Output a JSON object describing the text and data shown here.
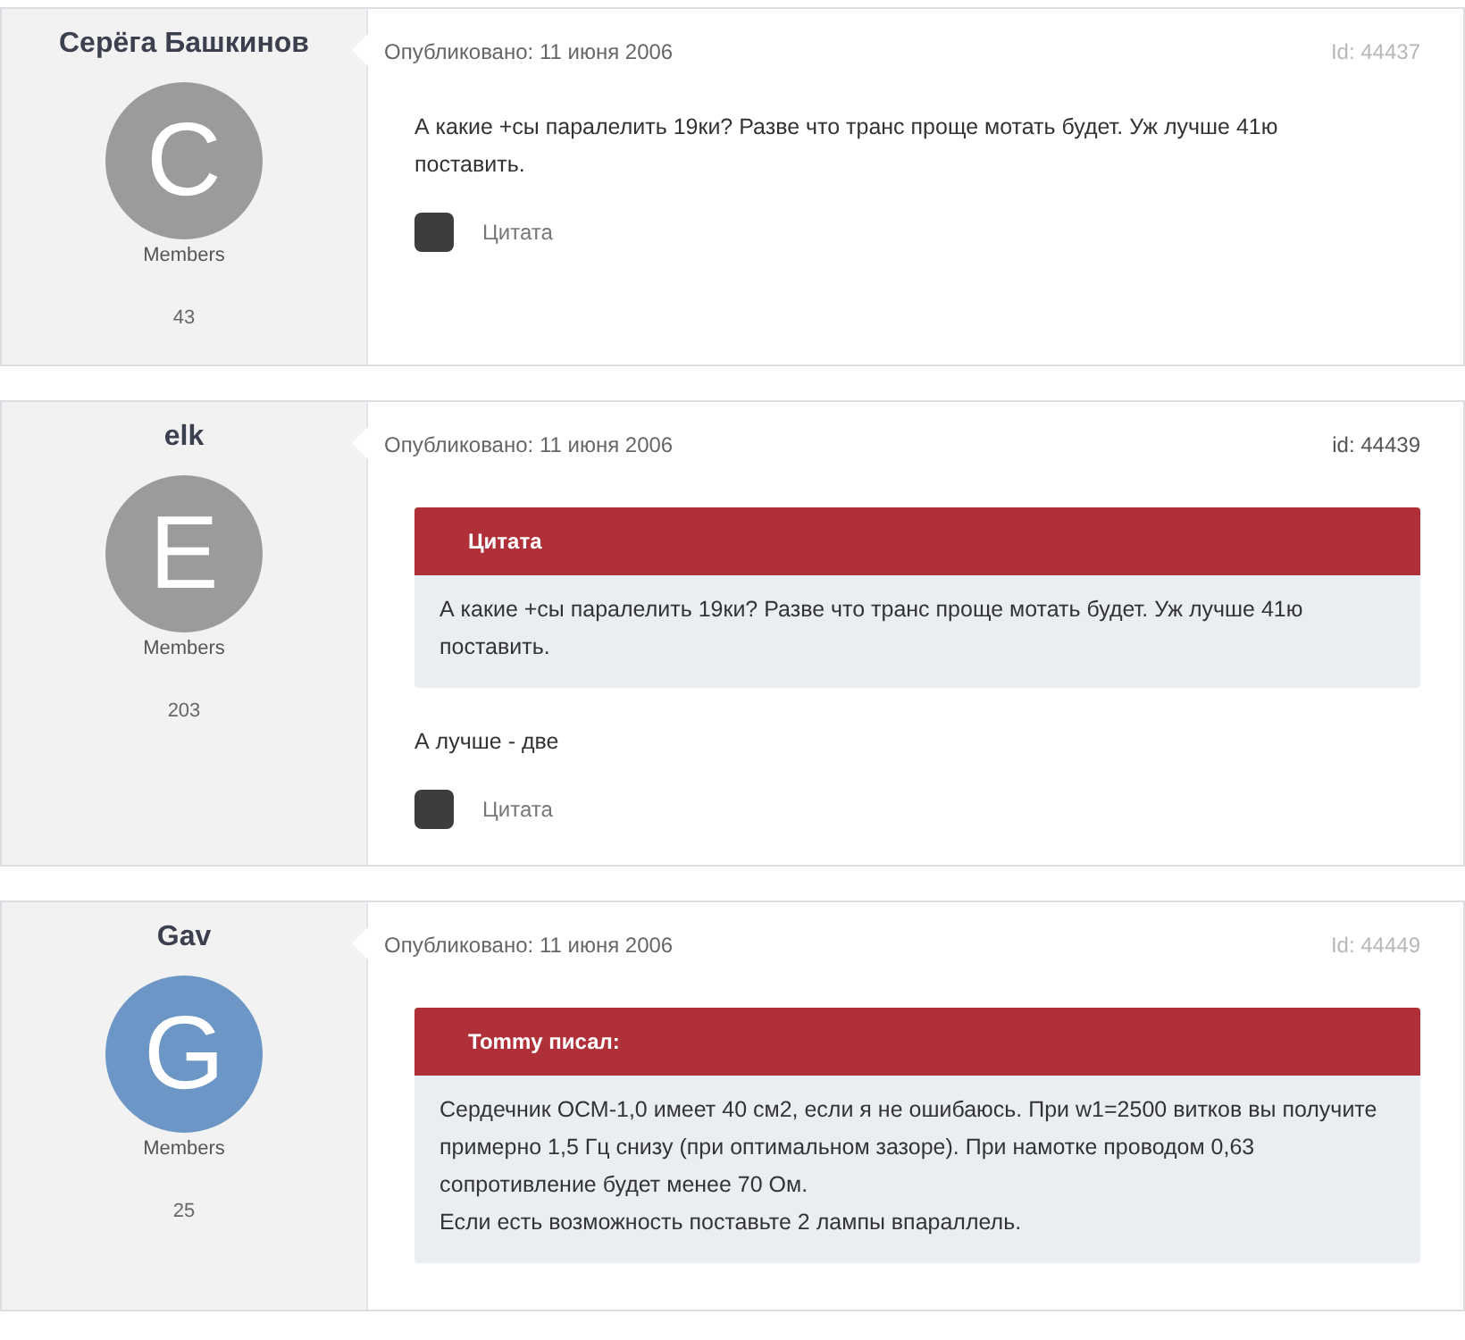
{
  "posts": [
    {
      "author": "Серёга Башкинов",
      "avatar_letter": "C",
      "color": "#9b9b9b",
      "group": "Members",
      "post_count": "43",
      "published": "Опубликовано: 11 июня 2006",
      "post_id": "Id: 44437",
      "id_dimmed": true,
      "paragraphs": [
        "А какие +сы паралелить 19ки? Разве что транс проще мотать будет. Уж лучше 41ю поставить."
      ],
      "quote_button": "Цитата"
    },
    {
      "author": "elk",
      "avatar_letter": "E",
      "color": "#9b9b9b",
      "group": "Members",
      "post_count": "203",
      "published": "Опубликовано: 11 июня 2006",
      "post_id": "id: 44439",
      "id_dimmed": false,
      "quote": {
        "title": "Цитата",
        "paragraphs": [
          "А какие +сы паралелить 19ки? Разве что транс проще мотать будет. Уж лучше 41ю поставить."
        ]
      },
      "paragraphs": [
        "А лучше - две"
      ],
      "quote_button": "Цитата"
    },
    {
      "author": "Gav",
      "avatar_letter": "G",
      "color": "#6b96c6",
      "group": "Members",
      "post_count": "25",
      "published": "Опубликовано: 11 июня 2006",
      "post_id": "Id: 44449",
      "id_dimmed": true,
      "quote": {
        "title": "Tommy писал:",
        "paragraphs": [
          "Сердечник ОСМ-1,0 имеет 40 см2, если я не ошибаюсь. При w1=2500 витков вы получите примерно 1,5 Гц снизу (при оптимальном зазоре). При намотке проводом 0,63 сопротивление будет менее 70 Ом.",
          "Если есть возможность поставьте 2 лампы впараллель."
        ]
      }
    }
  ]
}
